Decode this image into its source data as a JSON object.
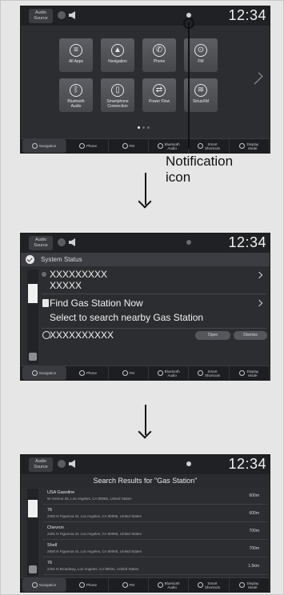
{
  "statusbar": {
    "audio_source": "Audio\nSource",
    "clock": "12:34"
  },
  "home": {
    "tiles": [
      {
        "label": "All Apps",
        "icon": "all-apps-icon",
        "glyph": "≡"
      },
      {
        "label": "Navigation",
        "icon": "navigation-icon",
        "glyph": "▲"
      },
      {
        "label": "Phone",
        "icon": "phone-icon",
        "glyph": "✆"
      },
      {
        "label": "FM",
        "icon": "fm-radio-icon",
        "glyph": "⊙"
      },
      {
        "label": "Bluetooth\nAudio",
        "icon": "bluetooth-icon",
        "glyph": "ᛒ"
      },
      {
        "label": "Smartphone\nConnection",
        "icon": "smartphone-icon",
        "glyph": "▯"
      },
      {
        "label": "Power Flow",
        "icon": "power-flow-icon",
        "glyph": "⇄"
      },
      {
        "label": "SiriusXM",
        "icon": "siriusxm-icon",
        "glyph": "≋"
      }
    ]
  },
  "bottombar": {
    "items": [
      {
        "label": "Navigation"
      },
      {
        "label": "Phone"
      },
      {
        "label": "FM"
      },
      {
        "label": "Bluetooth\nAudio"
      },
      {
        "label": "Smart\nShortcuts"
      },
      {
        "label": "Display\nMode"
      }
    ]
  },
  "callout": {
    "line1": "Notification",
    "line2": "icon"
  },
  "system_status": {
    "header": "System Status",
    "msg1_line1": "XXXXXXXXX",
    "msg1_line2": "XXXXX",
    "msg2_line1": "Find Gas Station Now",
    "msg2_line2": "Select to search nearby Gas Station",
    "msg3_line1": "XXXXXXXXXX",
    "open_label": "Open",
    "dismiss_label": "Dismiss"
  },
  "results": {
    "title": "Search Results for \"Gas Station\"",
    "rows": [
      {
        "name": "USA Gasoline",
        "address": "W Avenue 26, Los Angeles, CA 90065, United States",
        "distance": "600m"
      },
      {
        "name": "76",
        "address": "2250 N Figueroa St, Los Angeles, CA 90065, United States",
        "distance": "600m"
      },
      {
        "name": "Chevron",
        "address": "2401 N Figueroa St, Los Angeles, CA 90065, United States",
        "distance": "700m"
      },
      {
        "name": "Shell",
        "address": "2600 N Figueroa St, Los Angeles, CA 90065, United States",
        "distance": "700m"
      },
      {
        "name": "76",
        "address": "2401 N Broadway, Los Angeles, CA 90031, United States",
        "distance": "1.5km"
      }
    ]
  }
}
